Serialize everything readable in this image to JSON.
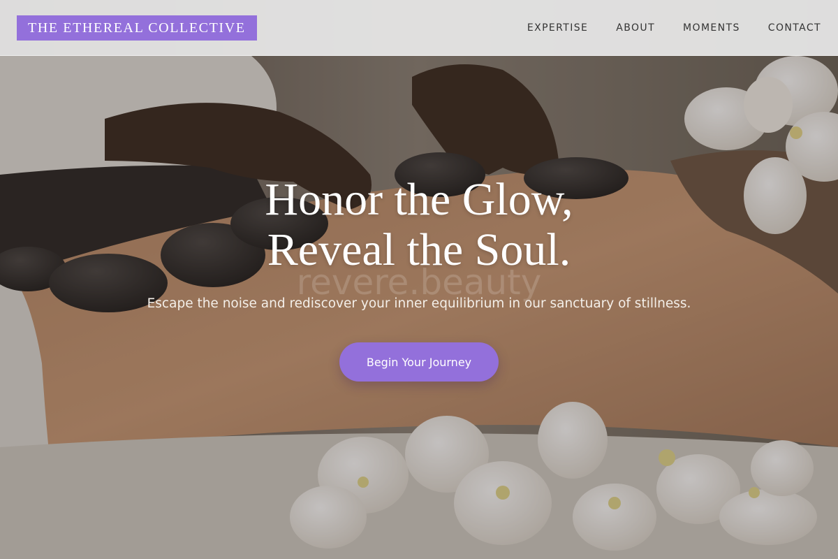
{
  "brand": {
    "name": "THE ETHEREAL COLLECTIVE",
    "accent_color": "#9370db"
  },
  "nav": {
    "items": [
      {
        "label": "EXPERTISE"
      },
      {
        "label": "ABOUT"
      },
      {
        "label": "MOMENTS"
      },
      {
        "label": "CONTACT"
      }
    ]
  },
  "hero": {
    "headline_line1": "Honor the Glow,",
    "headline_line2": "Reveal the Soul.",
    "watermark": "revere.beauty",
    "subtitle": "Escape the noise and rediscover your inner equilibrium in our sanctuary of stillness.",
    "cta_label": "Begin Your Journey",
    "background_image": "hot-stone-massage-photo"
  }
}
